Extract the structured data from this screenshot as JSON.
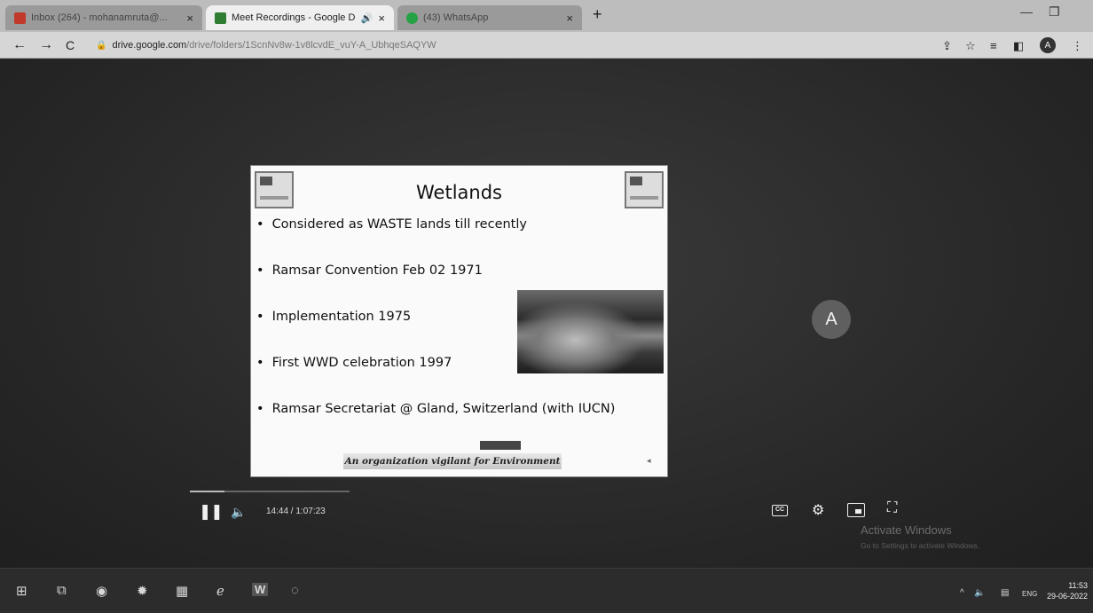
{
  "browser": {
    "tabs": [
      {
        "label": "Inbox (264) - mohanamruta@...",
        "favicon_color": "#c0392b",
        "active": false
      },
      {
        "label": "Meet Recordings - Google D",
        "favicon_color": "#2e7d32",
        "active": true
      },
      {
        "label": "(43) WhatsApp",
        "favicon_color": "#25a244",
        "active": false
      }
    ],
    "tab_close_glyph": "×",
    "tab_audio_glyph": "🔊",
    "new_tab_glyph": "+",
    "window_controls": {
      "minimize": "—",
      "maximize": "❐"
    },
    "nav": {
      "back": "←",
      "forward": "→",
      "reload": "C"
    },
    "address": {
      "host": "drive.google.com",
      "path": "/drive/folders/1ScnNv8w-1v8lcvdE_vuY-A_UbhqeSAQYW"
    },
    "toolbar_icons": {
      "share": "⇪",
      "bookmark": "☆",
      "reading_list": "≡",
      "side_panel": "◧",
      "menu": "⋮"
    },
    "profile_initial": "A"
  },
  "slide": {
    "title": "Wetlands",
    "bullets": [
      "Considered as WASTE lands till recently",
      "Ramsar Convention Feb 02 1971",
      "Implementation 1975",
      "First WWD celebration 1997",
      "Ramsar Secretariat @ Gland, Switzerland (with IUCN)"
    ],
    "footer": "An organization vigilant for Environment"
  },
  "participant": {
    "initial": "A"
  },
  "player": {
    "pause_glyph": "❚❚",
    "volume_glyph": "🔈",
    "time": "14:44 / 1:07:23",
    "cc_label": "CC",
    "settings_glyph": "⚙",
    "fullscreen_glyph": "⛶",
    "progress": 0.218
  },
  "watermark": {
    "title": "Activate Windows",
    "subtitle": "Go to Settings to activate Windows."
  },
  "taskbar": {
    "apps": [
      {
        "name": "start",
        "glyph": "⊞"
      },
      {
        "name": "task-view",
        "glyph": "⧉"
      },
      {
        "name": "chrome",
        "glyph": "◉"
      },
      {
        "name": "settings",
        "glyph": "✹"
      },
      {
        "name": "file-explorer",
        "glyph": "▦"
      },
      {
        "name": "edge",
        "glyph": "ℯ"
      },
      {
        "name": "word",
        "glyph": "W"
      },
      {
        "name": "chrome-2",
        "glyph": "◌"
      }
    ],
    "tray_up": "^",
    "tray_volume": "🔈",
    "tray_language": "ENG",
    "clock_time": "11:53",
    "clock_date": "29-06-2022"
  }
}
